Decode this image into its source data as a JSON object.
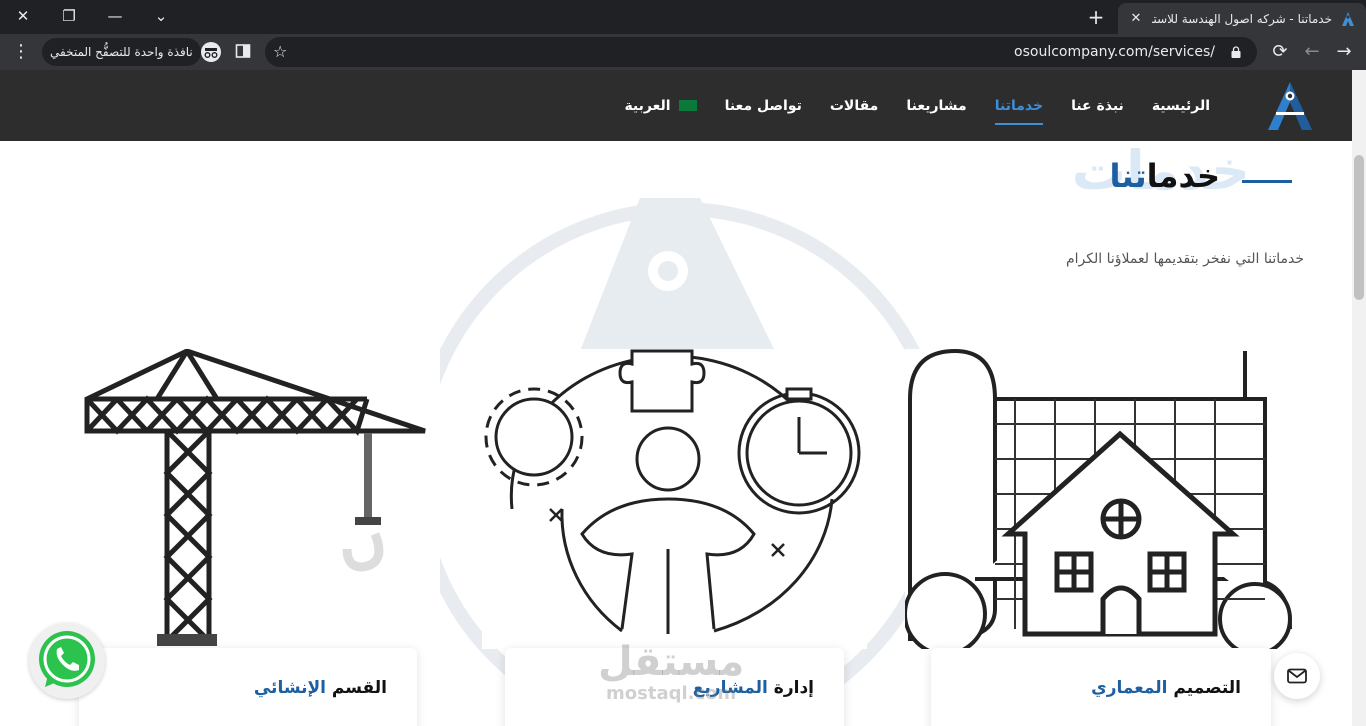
{
  "browser": {
    "tab_title": "خدماتنا - شركه اصول الهندسة للاستشارات",
    "url": "osoulcompany.com/services/",
    "incognito_label": "نافذة واحدة للتصفُّح المتخفي",
    "new_tab": "+",
    "close_tab": "✕"
  },
  "nav": {
    "items": [
      {
        "label": "الرئيسية",
        "active": false
      },
      {
        "label": "نبذة عنا",
        "active": false
      },
      {
        "label": "خدماتنا",
        "active": true
      },
      {
        "label": "مشاريعنا",
        "active": false
      },
      {
        "label": "مقالات",
        "active": false
      },
      {
        "label": "تواصل معنا",
        "active": false
      },
      {
        "label": "العربية",
        "active": false
      }
    ]
  },
  "section": {
    "ghost_title": "خدمات",
    "title_main": "خدما",
    "title_highlight": "تنا",
    "subtitle": "خدماتنا التي نفخر بتقديمها لعملاؤنا الكرام"
  },
  "cards": [
    {
      "title_main": "التصميم ",
      "title_highlight": "المعماري",
      "icon": "blueprint-house-icon"
    },
    {
      "title_main": "إدارة ",
      "title_highlight": "المشاريع",
      "icon": "project-management-icon"
    },
    {
      "title_main": "القسم ",
      "title_highlight": "الإنشائي",
      "icon": "tower-crane-icon"
    }
  ],
  "watermark": {
    "ar": "مستقل",
    "en": "mostaql.com"
  },
  "colors": {
    "accent": "#1d5fa0",
    "nav_bg": "#2d2d2d",
    "nav_active": "#3d8fd6"
  }
}
